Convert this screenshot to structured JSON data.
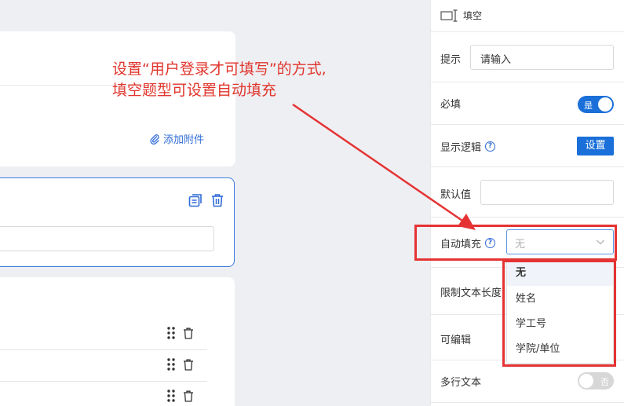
{
  "canvas": {
    "attach_label": "添加附件"
  },
  "panel": {
    "header_title": "填空",
    "hint_label": "提示",
    "hint_value": "请输入",
    "required_label": "必填",
    "required_toggle_text": "是",
    "display_logic_label": "显示逻辑",
    "display_logic_button": "设置",
    "default_label": "默认值",
    "autofill_label": "自动填充",
    "autofill_selected": "无",
    "limit_label": "限制文本长度",
    "editable_label": "可编辑",
    "multiline_label": "多行文本",
    "multiline_toggle_text": "否"
  },
  "dropdown": {
    "options": [
      "无",
      "姓名",
      "学工号",
      "学院/单位"
    ]
  },
  "annotation": {
    "line1": "设置“用户登录才可填写”的方式,",
    "line2": "填空题型可设置自动填充"
  },
  "colors": {
    "accent": "#1a6fd9",
    "annotation_red": "#e53333"
  }
}
